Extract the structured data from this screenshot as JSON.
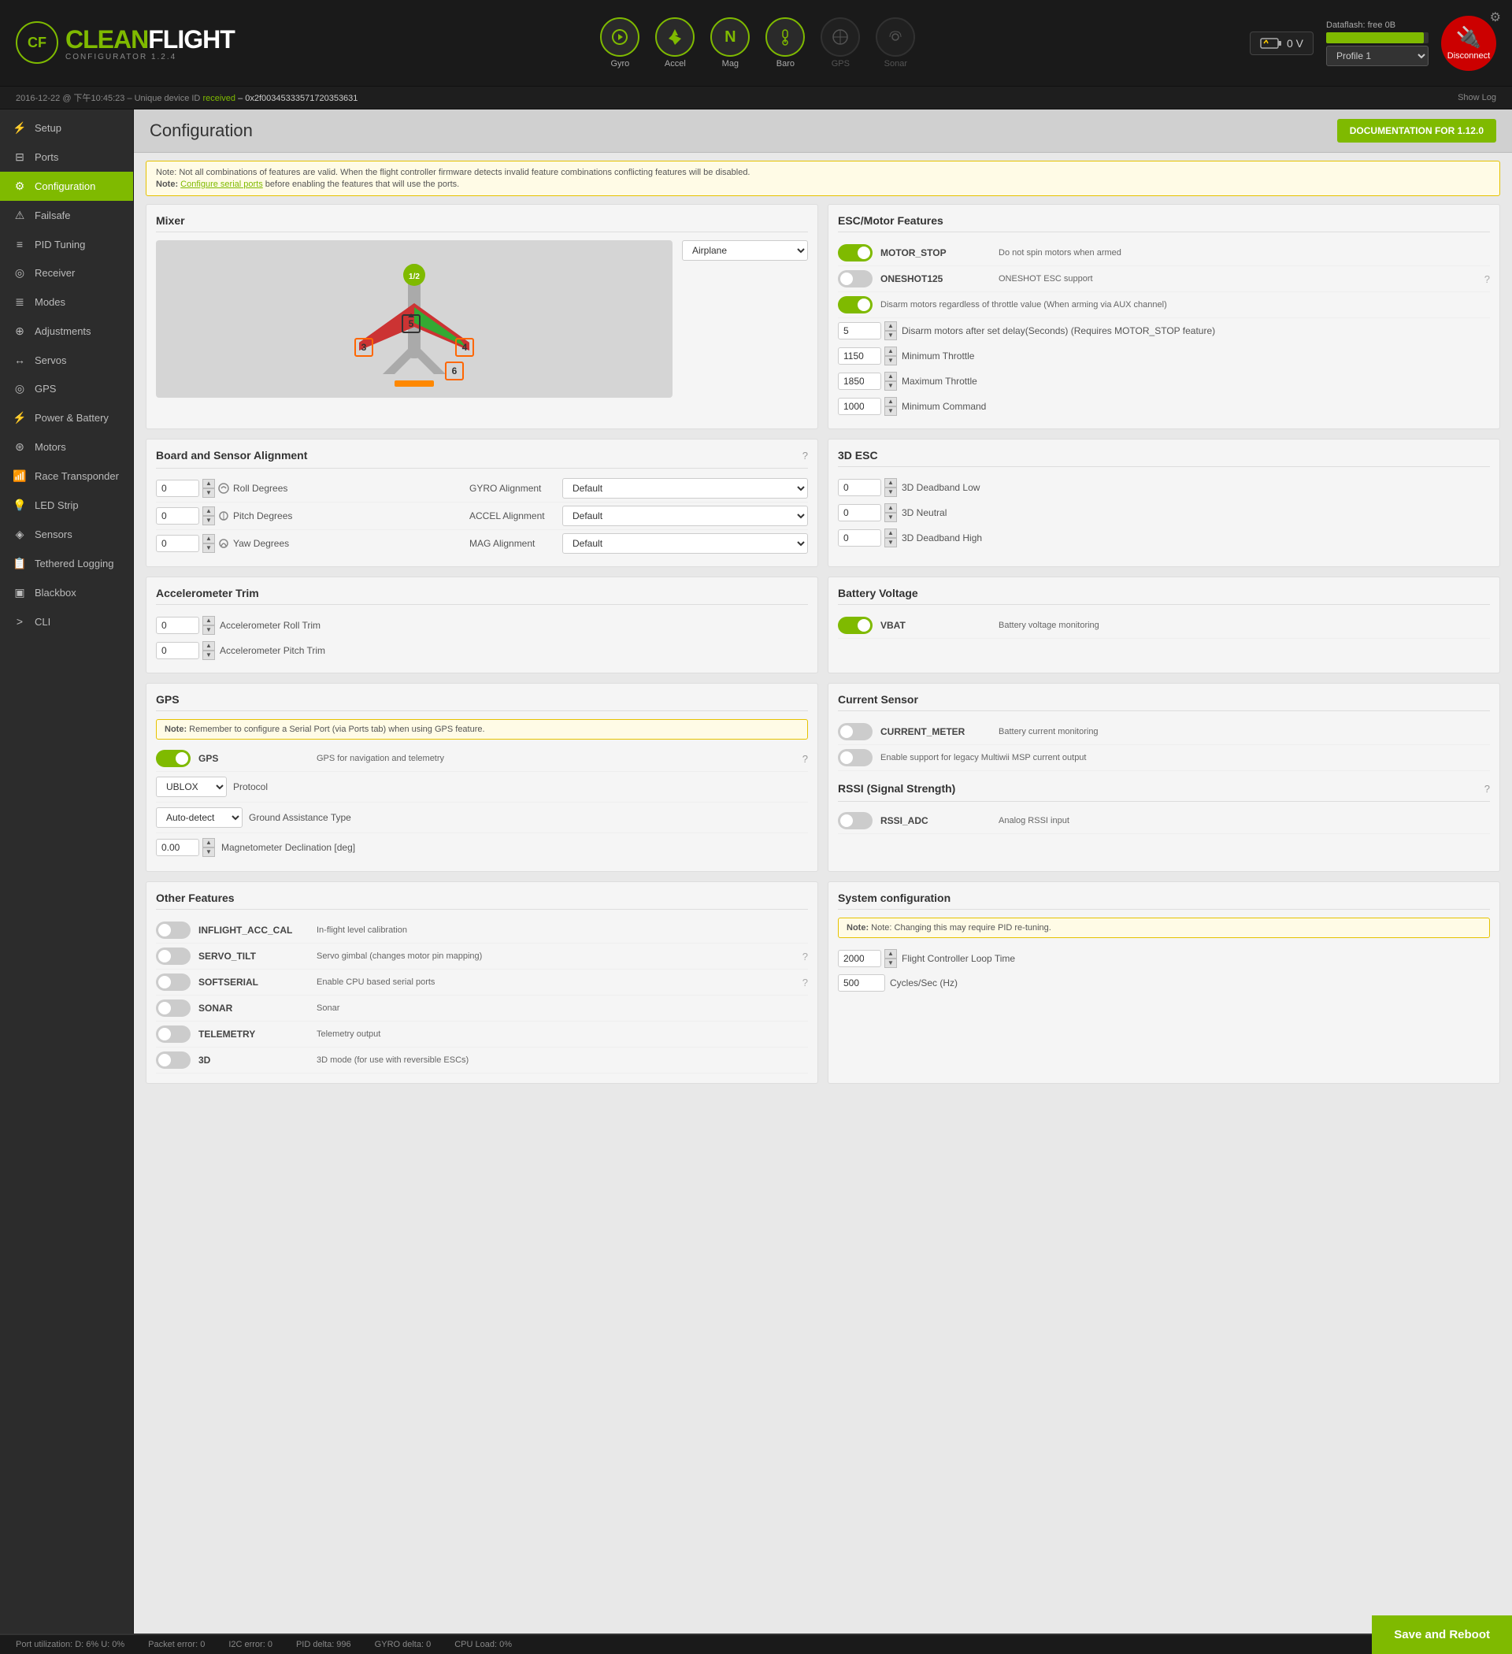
{
  "app": {
    "name_part1": "CLEAN",
    "name_part2": "FLIGHT",
    "configurator_version": "CONFIGURATOR 1.2.4"
  },
  "top_bar": {
    "voltage": "0 V",
    "dataflash_label": "Dataflash: free 0B",
    "dataflash_fill_pct": 95,
    "profile_label": "Profile 1",
    "disconnect_label": "Disconnect"
  },
  "status_bar": {
    "timestamp": "2016-12-22 @ 下午10:45:23",
    "unique_prefix": "– Unique device ID",
    "received_label": "received",
    "device_id": "– 0x2f00345333571720353631",
    "show_log": "Show Log"
  },
  "sensors": [
    {
      "id": "gyro",
      "label": "Gyro",
      "icon": "⚙",
      "active": true
    },
    {
      "id": "accel",
      "label": "Accel",
      "icon": "↑",
      "active": true
    },
    {
      "id": "mag",
      "label": "Mag",
      "icon": "N",
      "active": true
    },
    {
      "id": "baro",
      "label": "Baro",
      "icon": "🌡",
      "active": true
    },
    {
      "id": "gps",
      "label": "GPS",
      "icon": "⊕",
      "active": false
    },
    {
      "id": "sonar",
      "label": "Sonar",
      "icon": "◉",
      "active": false
    }
  ],
  "sidebar": {
    "items": [
      {
        "id": "setup",
        "label": "Setup",
        "icon": "⚡"
      },
      {
        "id": "ports",
        "label": "Ports",
        "icon": "⊟"
      },
      {
        "id": "configuration",
        "label": "Configuration",
        "icon": "⚙",
        "active": true
      },
      {
        "id": "failsafe",
        "label": "Failsafe",
        "icon": "⚠"
      },
      {
        "id": "pid-tuning",
        "label": "PID Tuning",
        "icon": "≡"
      },
      {
        "id": "receiver",
        "label": "Receiver",
        "icon": "📡"
      },
      {
        "id": "modes",
        "label": "Modes",
        "icon": "≣"
      },
      {
        "id": "adjustments",
        "label": "Adjustments",
        "icon": "⊕"
      },
      {
        "id": "servos",
        "label": "Servos",
        "icon": "↔"
      },
      {
        "id": "gps",
        "label": "GPS",
        "icon": "◎"
      },
      {
        "id": "power-battery",
        "label": "Power & Battery",
        "icon": "⚡"
      },
      {
        "id": "motors",
        "label": "Motors",
        "icon": "⊛"
      },
      {
        "id": "race-transponder",
        "label": "Race Transponder",
        "icon": "📶"
      },
      {
        "id": "led-strip",
        "label": "LED Strip",
        "icon": "💡"
      },
      {
        "id": "sensors",
        "label": "Sensors",
        "icon": "◈"
      },
      {
        "id": "tethered-logging",
        "label": "Tethered Logging",
        "icon": "📋"
      },
      {
        "id": "blackbox",
        "label": "Blackbox",
        "icon": "▣"
      },
      {
        "id": "cli",
        "label": "CLI",
        "icon": ">"
      }
    ]
  },
  "page": {
    "title": "Configuration",
    "doc_btn": "DOCUMENTATION FOR 1.12.0",
    "notice1": "Note: Not all combinations of features are valid. When the flight controller firmware detects invalid feature combinations conflicting features will be disabled.",
    "notice2_prefix": "Note:",
    "notice2_link": "Configure serial ports",
    "notice2_suffix": "before enabling the features that will use the ports."
  },
  "mixer": {
    "section_title": "Mixer",
    "type_label": "Airplane",
    "motor_badge": "1/2",
    "motors": [
      "3",
      "4",
      "5",
      "6"
    ]
  },
  "esc_motor": {
    "section_title": "ESC/Motor Features",
    "features": [
      {
        "id": "motor-stop",
        "name": "MOTOR_STOP",
        "desc": "Do not spin motors when armed",
        "enabled": true
      },
      {
        "id": "oneshot125",
        "name": "ONESHOT125",
        "desc": "ONESHOT ESC support",
        "enabled": false,
        "has_help": true
      },
      {
        "id": "disarm-motors",
        "name": "",
        "desc": "Disarm motors regardless of throttle value (When arming via AUX channel)",
        "enabled": true
      }
    ],
    "delay_label": "Disarm motors after set delay(Seconds) (Requires MOTOR_STOP feature)",
    "delay_value": "5",
    "min_throttle_label": "Minimum Throttle",
    "min_throttle_value": "1150",
    "max_throttle_label": "Maximum Throttle",
    "max_throttle_value": "1850",
    "min_command_label": "Minimum Command",
    "min_command_value": "1000"
  },
  "board_sensor_alignment": {
    "section_title": "Board and Sensor Alignment",
    "roll_label": "Roll Degrees",
    "roll_value": "0",
    "gyro_label": "GYRO Alignment",
    "gyro_value": "Default",
    "pitch_label": "Pitch Degrees",
    "pitch_value": "0",
    "accel_label": "ACCEL Alignment",
    "accel_value": "Default",
    "yaw_label": "Yaw Degrees",
    "yaw_value": "0",
    "mag_label": "MAG Alignment",
    "mag_value": "Default"
  },
  "three_d_esc": {
    "section_title": "3D ESC",
    "deadband_low_label": "3D Deadband Low",
    "deadband_low_value": "0",
    "neutral_label": "3D Neutral",
    "neutral_value": "0",
    "deadband_high_label": "3D Deadband High",
    "deadband_high_value": "0"
  },
  "accelerometer_trim": {
    "section_title": "Accelerometer Trim",
    "roll_label": "Accelerometer Roll Trim",
    "roll_value": "0",
    "pitch_label": "Accelerometer Pitch Trim",
    "pitch_value": "0"
  },
  "battery_voltage": {
    "section_title": "Battery Voltage",
    "vbat_name": "VBAT",
    "vbat_desc": "Battery voltage monitoring",
    "vbat_enabled": true
  },
  "gps_section": {
    "section_title": "GPS",
    "note": "Note: Remember to configure a Serial Port (via Ports tab) when using GPS feature.",
    "gps_label": "GPS",
    "gps_desc": "GPS for navigation and telemetry",
    "gps_enabled": true,
    "protocol_label": "Protocol",
    "protocol_value": "UBLOX",
    "ground_assist_label": "Ground Assistance Type",
    "ground_assist_value": "Auto-detect",
    "mag_decl_label": "Magnetometer Declination [deg]",
    "mag_decl_value": "0.00"
  },
  "current_sensor": {
    "section_title": "Current Sensor",
    "current_meter_name": "CURRENT_METER",
    "current_meter_desc": "Battery current monitoring",
    "current_meter_enabled": false,
    "legacy_desc": "Enable support for legacy Multiwii MSP current output",
    "legacy_enabled": false
  },
  "rssi": {
    "section_title": "RSSI (Signal Strength)",
    "rssi_adc_name": "RSSI_ADC",
    "rssi_adc_desc": "Analog RSSI input",
    "rssi_adc_enabled": false
  },
  "other_features": {
    "section_title": "Other Features",
    "features": [
      {
        "id": "inflight-acc-cal",
        "name": "INFLIGHT_ACC_CAL",
        "desc": "In-flight level calibration",
        "enabled": false
      },
      {
        "id": "servo-tilt",
        "name": "SERVO_TILT",
        "desc": "Servo gimbal (changes motor pin mapping)",
        "enabled": false,
        "has_help": true
      },
      {
        "id": "softserial",
        "name": "SOFTSERIAL",
        "desc": "Enable CPU based serial ports",
        "enabled": false,
        "has_help": true
      },
      {
        "id": "sonar",
        "name": "SONAR",
        "desc": "Sonar",
        "enabled": false
      },
      {
        "id": "telemetry",
        "name": "TELEMETRY",
        "desc": "Telemetry output",
        "enabled": false
      },
      {
        "id": "3d",
        "name": "3D",
        "desc": "3D mode (for use with reversible ESCs)",
        "enabled": false
      }
    ]
  },
  "system_config": {
    "section_title": "System configuration",
    "note": "Note: Changing this may require PID re-tuning.",
    "loop_time_label": "Flight Controller Loop Time",
    "loop_time_value": "2000",
    "cycles_label": "Cycles/Sec (Hz)",
    "cycles_value": "500"
  },
  "bottom_bar": {
    "port_util": "Port utilization: D: 6% U: 0%",
    "packet_error": "Packet error: 0",
    "i2c_error": "I2C error: 0",
    "pid_delta": "PID delta: 996",
    "gyro_delta": "GYRO delta: 0",
    "cpu_load": "CPU Load: 0%"
  },
  "save_btn": "Save and Reboot"
}
